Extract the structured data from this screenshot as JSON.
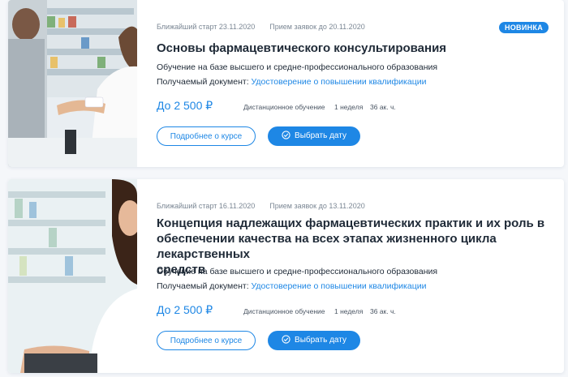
{
  "courses": [
    {
      "start": "Ближайший старт 23.11.2020",
      "deadline": "Прием заявок до 20.11.2020",
      "badge": "НОВИНКА",
      "title": "Основы фармацевтического консультирования",
      "education": "Обучение на базе высшего и средне-профессионального образования",
      "document_label": "Получаемый документ:",
      "document_link": "Удостоверение о повышении квалификации",
      "price": "До 2 500 ₽",
      "format": "Дистанционное обучение",
      "duration": "1 неделя",
      "hours": "36 ак. ч.",
      "details_button": "Подробнее о курсе",
      "date_button": "Выбрать дату"
    },
    {
      "start": "Ближайший старт 16.11.2020",
      "deadline": "Прием заявок до 13.11.2020",
      "title_lines": [
        "Концепция надлежащих фармацевтических практик и их роль в",
        "обеспечении качества на всех этапах жизненного цикла лекарственных",
        "средств"
      ],
      "education": "Обучение на базе высшего и средне-профессионального образования",
      "document_label": "Получаемый документ:",
      "document_link": "Удостоверение о повышении квалификации",
      "price": "До 2 500 ₽",
      "format": "Дистанционное обучение",
      "duration": "1 неделя",
      "hours": "36 ак. ч.",
      "details_button": "Подробнее о курсе",
      "date_button": "Выбрать дату"
    }
  ],
  "colors": {
    "accent": "#1e87e5",
    "text": "#1f2a37",
    "muted": "#7b8794"
  }
}
